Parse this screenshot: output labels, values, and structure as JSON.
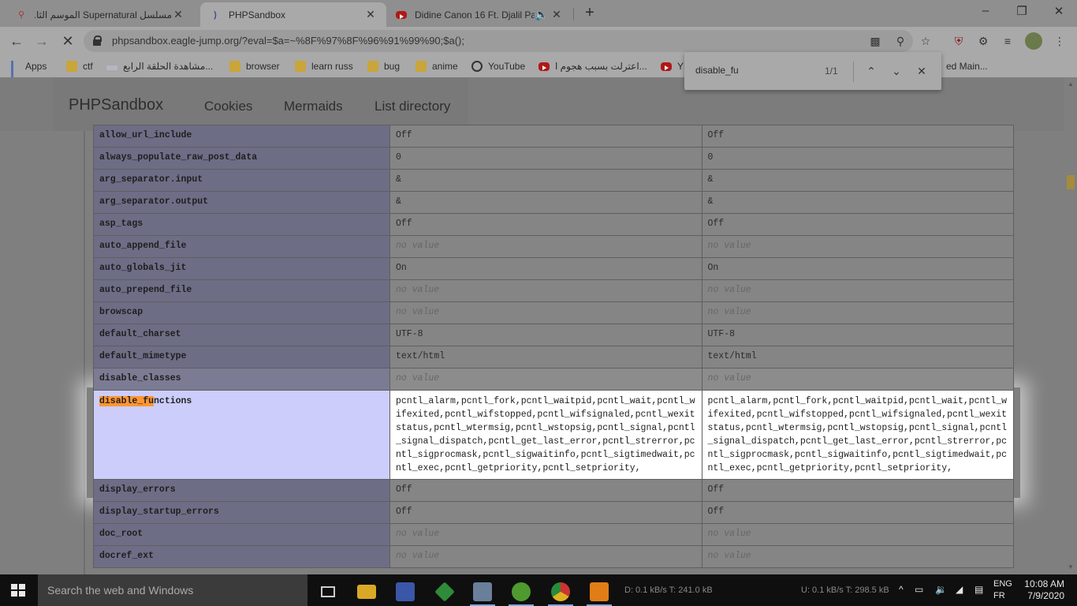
{
  "tabs": [
    {
      "title": "مسلسل Supernatural الموسم الثا...",
      "active": false
    },
    {
      "title": "PHPSandbox",
      "active": true
    },
    {
      "title": "Didine Canon 16 Ft. Djalil Pal...",
      "active": false,
      "audio": true
    }
  ],
  "omnibox": {
    "url": "phpsandbox.eagle-jump.org/?eval=$a=~%8F%97%8F%96%91%99%90;$a();"
  },
  "bookmarks": [
    {
      "label": "Apps",
      "icon": "apps-grid-icon"
    },
    {
      "label": "ctf",
      "icon": "folder-icon"
    },
    {
      "label": "مشاهدة الحلقة الرابع...",
      "icon": "site-icon"
    },
    {
      "label": "browser",
      "icon": "folder-icon"
    },
    {
      "label": "learn russ",
      "icon": "folder-icon"
    },
    {
      "label": "bug",
      "icon": "folder-icon"
    },
    {
      "label": "anime",
      "icon": "folder-icon"
    },
    {
      "label": "YouTube",
      "icon": "globe-icon"
    },
    {
      "label": "اعترلت بسبب هجوم ا...",
      "icon": "youtube-icon"
    },
    {
      "label": "Y",
      "icon": "youtube-icon"
    },
    {
      "label": "ed Main...",
      "icon": "none"
    }
  ],
  "findbar": {
    "query": "disable_fu",
    "count": "1/1"
  },
  "site": {
    "brand": "PHPSandbox",
    "nav": [
      "Cookies",
      "Mermaids",
      "List directory"
    ]
  },
  "ini_rows": [
    {
      "key": "allow_url_include",
      "local": "Off",
      "master": "Off"
    },
    {
      "key": "always_populate_raw_post_data",
      "local": "0",
      "master": "0"
    },
    {
      "key": "arg_separator.input",
      "local": "&",
      "master": "&"
    },
    {
      "key": "arg_separator.output",
      "local": "&",
      "master": "&"
    },
    {
      "key": "asp_tags",
      "local": "Off",
      "master": "Off"
    },
    {
      "key": "auto_append_file",
      "local": "no value",
      "master": "no value"
    },
    {
      "key": "auto_globals_jit",
      "local": "On",
      "master": "On"
    },
    {
      "key": "auto_prepend_file",
      "local": "no value",
      "master": "no value"
    },
    {
      "key": "browscap",
      "local": "no value",
      "master": "no value"
    },
    {
      "key": "default_charset",
      "local": "UTF-8",
      "master": "UTF-8"
    },
    {
      "key": "default_mimetype",
      "local": "text/html",
      "master": "text/html"
    },
    {
      "key": "disable_classes",
      "local": "no value",
      "master": "no value"
    },
    {
      "key": "disable_functions",
      "match_prefix": "disable_fu",
      "match_rest": "nctions",
      "local": "pcntl_alarm,pcntl_fork,pcntl_waitpid,pcntl_wait,pcntl_wifexited,pcntl_wifstopped,pcntl_wifsignaled,pcntl_wexitstatus,pcntl_wtermsig,pcntl_wstopsig,pcntl_signal,pcntl_signal_dispatch,pcntl_get_last_error,pcntl_strerror,pcntl_sigprocmask,pcntl_sigwaitinfo,pcntl_sigtimedwait,pcntl_exec,pcntl_getpriority,pcntl_setpriority,",
      "master": "pcntl_alarm,pcntl_fork,pcntl_waitpid,pcntl_wait,pcntl_wifexited,pcntl_wifstopped,pcntl_wifsignaled,pcntl_wexitstatus,pcntl_wtermsig,pcntl_wstopsig,pcntl_signal,pcntl_signal_dispatch,pcntl_get_last_error,pcntl_strerror,pcntl_sigprocmask,pcntl_sigwaitinfo,pcntl_sigtimedwait,pcntl_exec,pcntl_getpriority,pcntl_setpriority,"
    },
    {
      "key": "display_errors",
      "local": "Off",
      "master": "Off"
    },
    {
      "key": "display_startup_errors",
      "local": "Off",
      "master": "Off"
    },
    {
      "key": "doc_root",
      "local": "no value",
      "master": "no value"
    },
    {
      "key": "docref_ext",
      "local": "no value",
      "master": "no value"
    }
  ],
  "taskbar": {
    "search_placeholder": "Search the web and Windows",
    "net_down": "D: 0.1 kB/s T: 241.0 kB",
    "net_up": "U: 0.1 kB/s T: 298.5 kB",
    "lang_top": "ENG",
    "lang_bottom": "FR",
    "time": "10:08 AM",
    "date": "7/9/2020"
  },
  "colors": {
    "find_highlight": "#ff9632",
    "ini_key_bg": "#cccdfb",
    "accent_scroll": "#a58b3c"
  }
}
